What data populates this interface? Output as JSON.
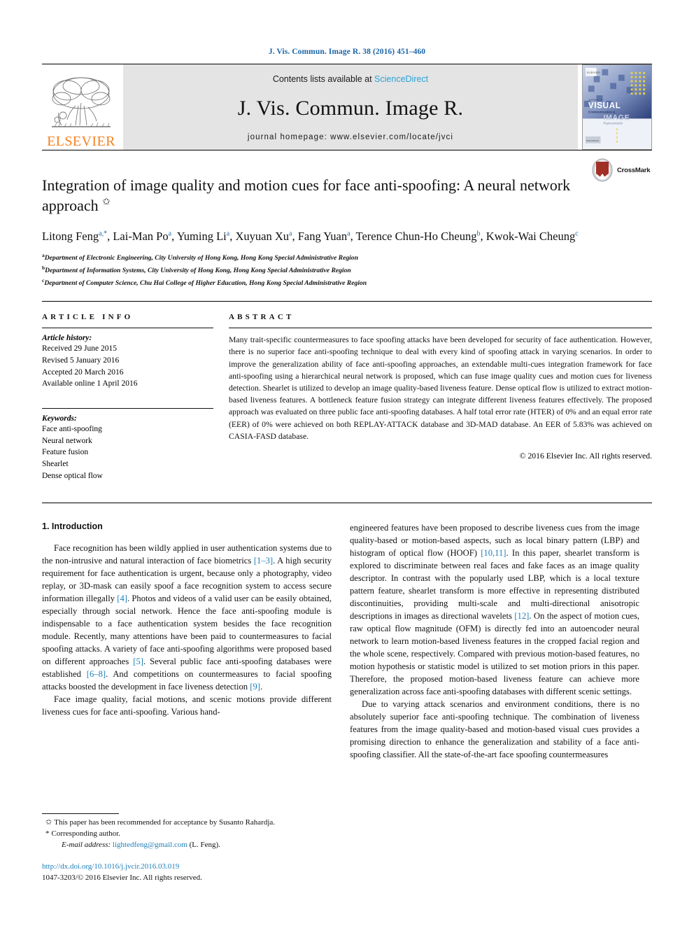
{
  "running_head": "J. Vis. Commun. Image R. 38 (2016) 451–460",
  "masthead": {
    "publisher_logo_text": "ELSEVIER",
    "contents_prefix": "Contents lists available at ",
    "contents_link": "ScienceDirect",
    "journal_title": "J. Vis. Commun. Image R.",
    "homepage": "journal homepage: www.elsevier.com/locate/jvci",
    "cover_lines": [
      "JOURNAL OF",
      "VISUAL",
      "Communication &",
      "IMAGE",
      "Representation"
    ]
  },
  "article": {
    "title": "Integration of image quality and motion cues for face anti-spoofing: A neural network approach",
    "title_marker": "✩",
    "crossmark_label": "CrossMark",
    "authors": [
      {
        "name": "Litong Feng",
        "sup": "a,*"
      },
      {
        "name": "Lai-Man Po",
        "sup": "a"
      },
      {
        "name": "Yuming Li",
        "sup": "a"
      },
      {
        "name": "Xuyuan Xu",
        "sup": "a"
      },
      {
        "name": "Fang Yuan",
        "sup": "a"
      },
      {
        "name": "Terence Chun-Ho Cheung",
        "sup": "b"
      },
      {
        "name": "Kwok-Wai Cheung",
        "sup": "c"
      }
    ],
    "affiliations": [
      {
        "mark": "a",
        "text": "Department of Electronic Engineering, City University of Hong Kong, Hong Kong Special Administrative Region"
      },
      {
        "mark": "b",
        "text": "Department of Information Systems, City University of Hong Kong, Hong Kong Special Administrative Region"
      },
      {
        "mark": "c",
        "text": "Department of Computer Science, Chu Hai College of Higher Education, Hong Kong Special Administrative Region"
      }
    ]
  },
  "article_info": {
    "heading": "ARTICLE INFO",
    "history_title": "Article history:",
    "history": [
      "Received 29 June 2015",
      "Revised 5 January 2016",
      "Accepted 20 March 2016",
      "Available online 1 April 2016"
    ],
    "keywords_title": "Keywords:",
    "keywords": [
      "Face anti-spoofing",
      "Neural network",
      "Feature fusion",
      "Shearlet",
      "Dense optical flow"
    ]
  },
  "abstract": {
    "heading": "ABSTRACT",
    "text": "Many trait-specific countermeasures to face spoofing attacks have been developed for security of face authentication. However, there is no superior face anti-spoofing technique to deal with every kind of spoofing attack in varying scenarios. In order to improve the generalization ability of face anti-spoofing approaches, an extendable multi-cues integration framework for face anti-spoofing using a hierarchical neural network is proposed, which can fuse image quality cues and motion cues for liveness detection. Shearlet is utilized to develop an image quality-based liveness feature. Dense optical flow is utilized to extract motion-based liveness features. A bottleneck feature fusion strategy can integrate different liveness features effectively. The proposed approach was evaluated on three public face anti-spoofing databases. A half total error rate (HTER) of 0% and an equal error rate (EER) of 0% were achieved on both REPLAY-ATTACK database and 3D-MAD database. An EER of 5.83% was achieved on CASIA-FASD database.",
    "copyright": "© 2016 Elsevier Inc. All rights reserved."
  },
  "body": {
    "section_heading": "1. Introduction",
    "left_paragraphs": [
      "Face recognition has been wildly applied in user authentication systems due to the non-intrusive and natural interaction of face biometrics [1–3]. A high security requirement for face authentication is urgent, because only a photography, video replay, or 3D-mask can easily spoof a face recognition system to access secure information illegally [4]. Photos and videos of a valid user can be easily obtained, especially through social network. Hence the face anti-spoofing module is indispensable to a face authentication system besides the face recognition module. Recently, many attentions have been paid to countermeasures to facial spoofing attacks. A variety of face anti-spoofing algorithms were proposed based on different approaches [5]. Several public face anti-spoofing databases were established [6–8]. And competitions on countermeasures to facial spoofing attacks boosted the development in face liveness detection [9].",
      "Face image quality, facial motions, and scenic motions provide different liveness cues for face anti-spoofing. Various hand-"
    ],
    "right_paragraphs": [
      "engineered features have been proposed to describe liveness cues from the image quality-based or motion-based aspects, such as local binary pattern (LBP) and histogram of optical flow (HOOF) [10,11]. In this paper, shearlet transform is explored to discriminate between real faces and fake faces as an image quality descriptor. In contrast with the popularly used LBP, which is a local texture pattern feature, shearlet transform is more effective in representing distributed discontinuities, providing multi-scale and multi-directional anisotropic descriptions in images as directional wavelets [12]. On the aspect of motion cues, raw optical flow magnitude (OFM) is directly fed into an autoencoder neural network to learn motion-based liveness features in the cropped facial region and the whole scene, respectively. Compared with previous motion-based features, no motion hypothesis or statistic model is utilized to set motion priors in this paper. Therefore, the proposed motion-based liveness feature can achieve more generalization across face anti-spoofing databases with different scenic settings.",
      "Due to varying attack scenarios and environment conditions, there is no absolutely superior face anti-spoofing technique. The combination of liveness features from the image quality-based and motion-based visual cues provides a promising direction to enhance the generalization and stability of a face anti-spoofing classifier. All the state-of-the-art face spoofing countermeasures"
    ]
  },
  "footnotes": {
    "note_star": "This paper has been recommended for acceptance by Susanto Rahardja.",
    "note_corr": "Corresponding author.",
    "email_label": "E-mail address:",
    "email": "lightedfeng@gmail.com",
    "email_owner": "(L. Feng).",
    "doi": "http://dx.doi.org/10.1016/j.jvcir.2016.03.019",
    "issn_line": "1047-3203/© 2016 Elsevier Inc. All rights reserved."
  },
  "colors": {
    "link_blue": "#1c7fb8",
    "running_head_blue": "#1c66a8",
    "sciencedirect_blue": "#2aa3d8",
    "elsevier_orange": "#f58220",
    "band_gray": "#e4e4e4"
  }
}
